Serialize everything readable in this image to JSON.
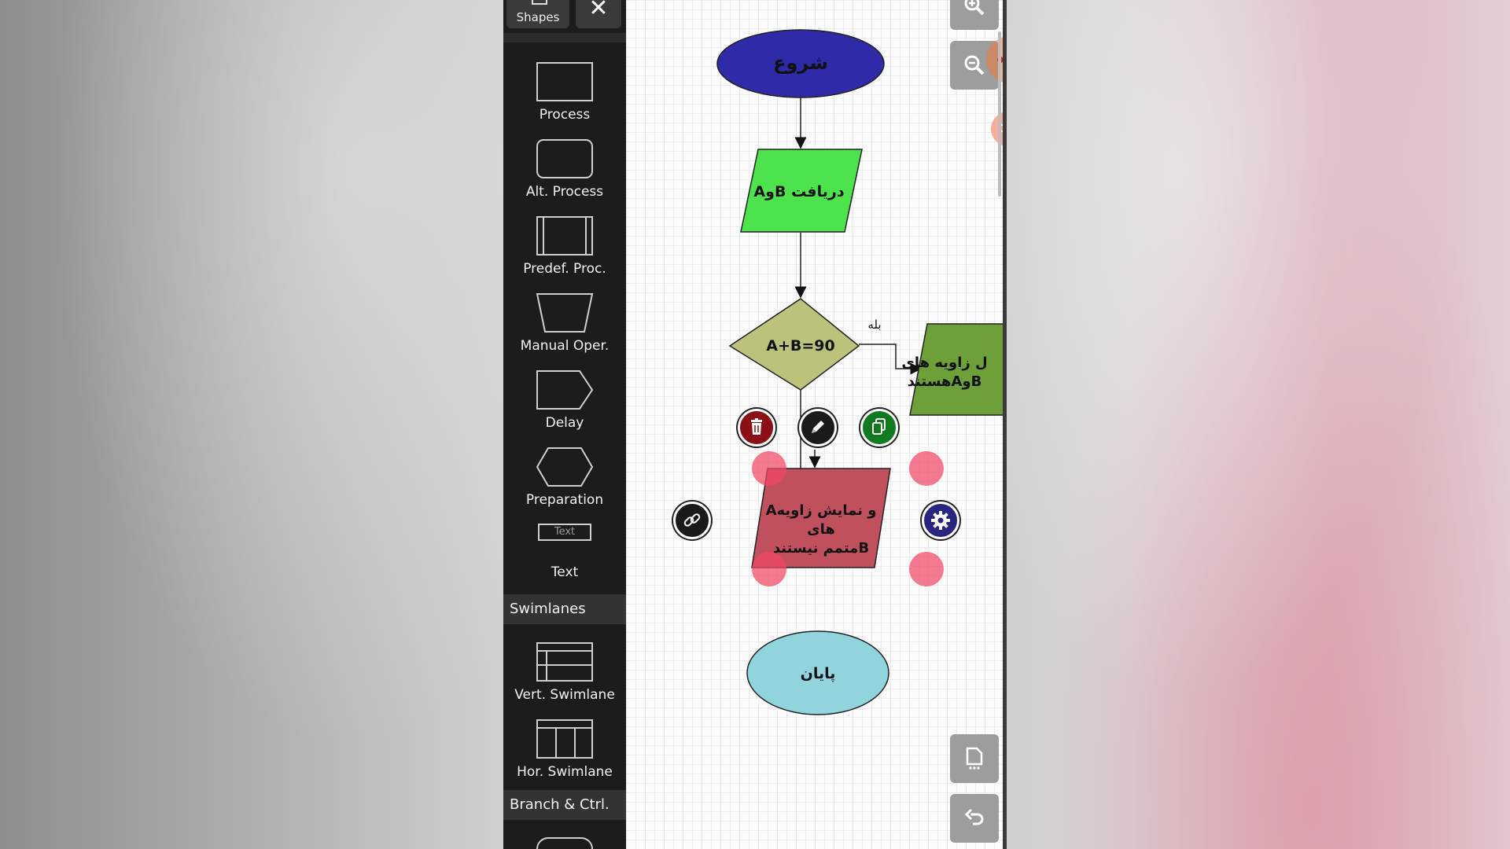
{
  "panel": {
    "tab_label": "Shapes",
    "close_symbol": "✕",
    "shapes": [
      {
        "label": "Process",
        "icon": "process-icon"
      },
      {
        "label": "Alt. Process",
        "icon": "alt-process-icon"
      },
      {
        "label": "Predef. Proc.",
        "icon": "predefined-process-icon"
      },
      {
        "label": "Manual Oper.",
        "icon": "manual-operation-icon"
      },
      {
        "label": "Delay",
        "icon": "delay-icon"
      },
      {
        "label": "Preparation",
        "icon": "preparation-icon"
      },
      {
        "label": "Text",
        "preview_text": "Text",
        "icon": "text-icon"
      }
    ],
    "section_swimlanes": "Swimlanes",
    "swimlanes": [
      {
        "label": "Vert. Swimlane",
        "icon": "vertical-swimlane-icon"
      },
      {
        "label": "Hor. Swimlane",
        "icon": "horizontal-swimlane-icon"
      }
    ],
    "section_branch": "Branch & Ctrl."
  },
  "flowchart": {
    "start": "شروع",
    "input": "AوB دریافت",
    "decision": "A+B=90",
    "yes_label": "بله",
    "yes_output_line1": "ل زاویه های",
    "yes_output_line2": "هستندAوB",
    "no_output_line1": "Aو نمایش زاویه های",
    "no_output_line2": "متمم نیستندB",
    "end": "پایان"
  },
  "colors": {
    "panel_bg": "#1c1c1c",
    "start_fill": "#2e2aa8",
    "input_fill": "#4de34d",
    "decision_fill": "#bcc27a",
    "yes_output_fill": "#6ea039",
    "no_output_fill": "#c1505e",
    "end_fill": "#92d4de",
    "handle": "#f04664"
  },
  "toolbar_icons": [
    "zoom-in-icon",
    "zoom-out-icon",
    "page-icon",
    "undo-icon"
  ],
  "context_icons": [
    "trash-icon",
    "pencil-icon",
    "copy-icon",
    "link-icon",
    "gear-icon"
  ]
}
